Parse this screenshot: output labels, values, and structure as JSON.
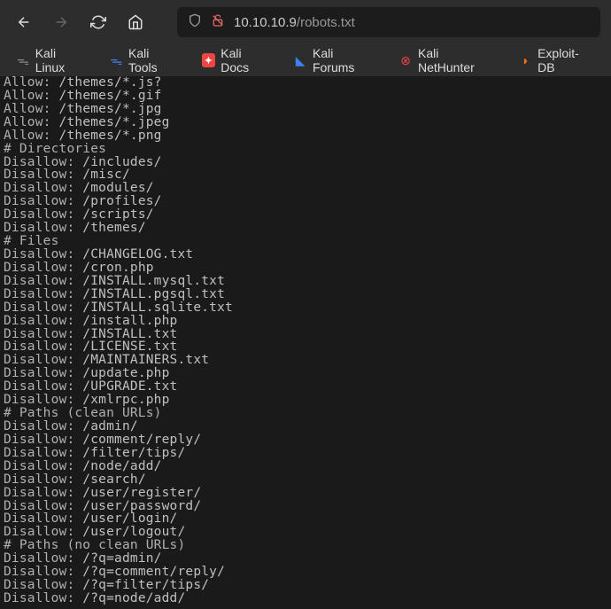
{
  "url": {
    "host": "10.10.10.9",
    "path": "/robots.txt"
  },
  "bookmarks": [
    {
      "label": "Kali Linux",
      "icon": "dragon",
      "color": "#333"
    },
    {
      "label": "Kali Tools",
      "icon": "dragon",
      "color": "#3b82f6"
    },
    {
      "label": "Kali Docs",
      "icon": "doc",
      "color": "#ef4444"
    },
    {
      "label": "Kali Forums",
      "icon": "forum",
      "color": "#3b82f6"
    },
    {
      "label": "Kali NetHunter",
      "icon": "hunter",
      "color": "#ef4444"
    },
    {
      "label": "Exploit-DB",
      "icon": "exploit",
      "color": "#f97316"
    }
  ],
  "robots_lines": [
    {
      "d": "Allow:",
      "v": " /themes/*.js?"
    },
    {
      "d": "Allow:",
      "v": " /themes/*.gif"
    },
    {
      "d": "Allow:",
      "v": " /themes/*.jpg"
    },
    {
      "d": "Allow:",
      "v": " /themes/*.jpeg"
    },
    {
      "d": "Allow:",
      "v": " /themes/*.png"
    },
    {
      "d": "# Directories",
      "v": ""
    },
    {
      "d": "Disallow:",
      "v": " /includes/"
    },
    {
      "d": "Disallow:",
      "v": " /misc/"
    },
    {
      "d": "Disallow:",
      "v": " /modules/"
    },
    {
      "d": "Disallow:",
      "v": " /profiles/"
    },
    {
      "d": "Disallow:",
      "v": " /scripts/"
    },
    {
      "d": "Disallow:",
      "v": " /themes/"
    },
    {
      "d": "# Files",
      "v": ""
    },
    {
      "d": "Disallow:",
      "v": " /CHANGELOG.txt"
    },
    {
      "d": "Disallow:",
      "v": " /cron.php"
    },
    {
      "d": "Disallow:",
      "v": " /INSTALL.mysql.txt"
    },
    {
      "d": "Disallow:",
      "v": " /INSTALL.pgsql.txt"
    },
    {
      "d": "Disallow:",
      "v": " /INSTALL.sqlite.txt"
    },
    {
      "d": "Disallow:",
      "v": " /install.php"
    },
    {
      "d": "Disallow:",
      "v": " /INSTALL.txt"
    },
    {
      "d": "Disallow:",
      "v": " /LICENSE.txt"
    },
    {
      "d": "Disallow:",
      "v": " /MAINTAINERS.txt"
    },
    {
      "d": "Disallow:",
      "v": " /update.php"
    },
    {
      "d": "Disallow:",
      "v": " /UPGRADE.txt"
    },
    {
      "d": "Disallow:",
      "v": " /xmlrpc.php"
    },
    {
      "d": "# Paths (clean URLs)",
      "v": ""
    },
    {
      "d": "Disallow:",
      "v": " /admin/"
    },
    {
      "d": "Disallow:",
      "v": " /comment/reply/"
    },
    {
      "d": "Disallow:",
      "v": " /filter/tips/"
    },
    {
      "d": "Disallow:",
      "v": " /node/add/"
    },
    {
      "d": "Disallow:",
      "v": " /search/"
    },
    {
      "d": "Disallow:",
      "v": " /user/register/"
    },
    {
      "d": "Disallow:",
      "v": " /user/password/"
    },
    {
      "d": "Disallow:",
      "v": " /user/login/"
    },
    {
      "d": "Disallow:",
      "v": " /user/logout/"
    },
    {
      "d": "# Paths (no clean URLs)",
      "v": ""
    },
    {
      "d": "Disallow:",
      "v": " /?q=admin/"
    },
    {
      "d": "Disallow:",
      "v": " /?q=comment/reply/"
    },
    {
      "d": "Disallow:",
      "v": " /?q=filter/tips/"
    },
    {
      "d": "Disallow:",
      "v": " /?q=node/add/"
    }
  ]
}
